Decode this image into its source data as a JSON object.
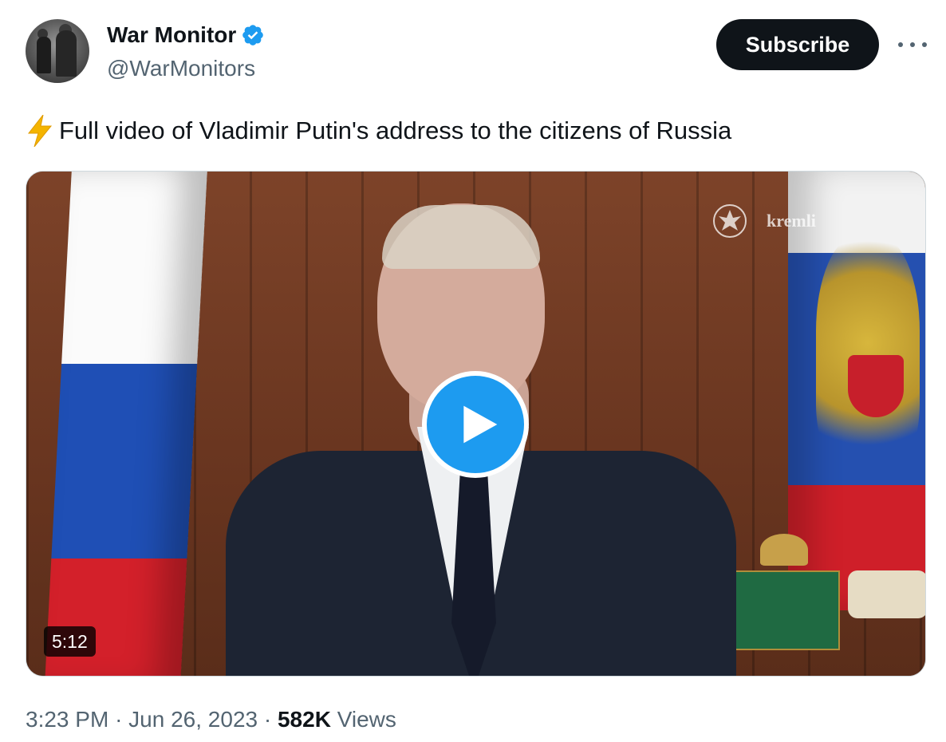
{
  "author": {
    "display_name": "War Monitor",
    "handle": "@WarMonitors",
    "verified_icon": "verified-badge-icon",
    "avatar_icon": "avatar-photo"
  },
  "actions": {
    "subscribe_label": "Subscribe",
    "more_icon": "more-icon"
  },
  "tweet": {
    "emoji_icon": "lightning-bolt-icon",
    "text": "Full video of Vladimir Putin's address to the citizens of Russia"
  },
  "media": {
    "type": "video",
    "watermark_text": "kremli",
    "duration": "5:12",
    "play_icon": "play-icon"
  },
  "meta": {
    "time": "3:23 PM",
    "separator_1": "·",
    "date": "Jun 26, 2023",
    "separator_2": "·",
    "views_count": "582K",
    "views_label": "Views"
  },
  "colors": {
    "accent": "#1d9bf0",
    "text_primary": "#0f1419",
    "text_secondary": "#536471",
    "button_bg": "#0f1419"
  }
}
